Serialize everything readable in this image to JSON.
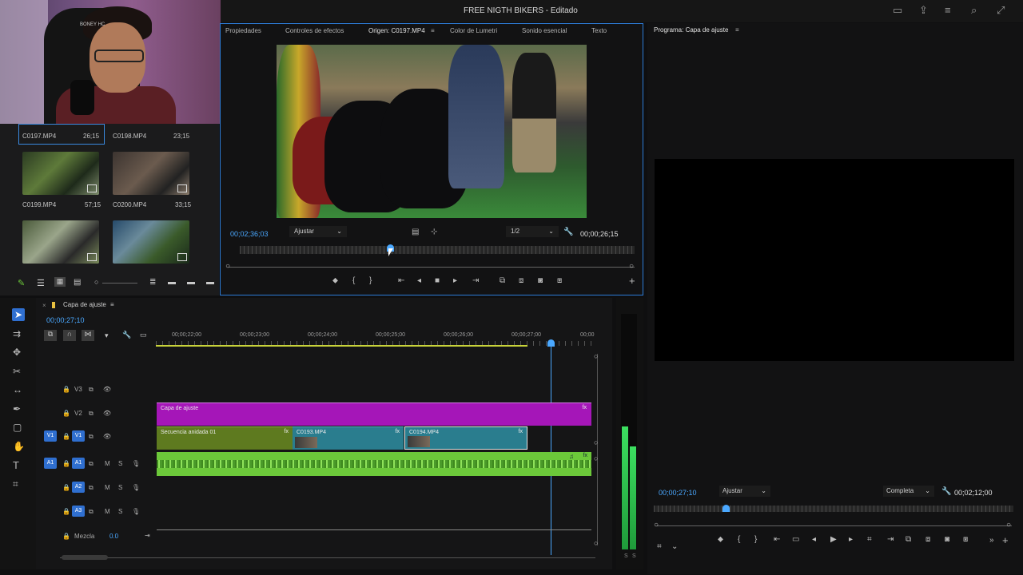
{
  "app": {
    "title": "FREE NIGTH BIKERS - Editado"
  },
  "webcam": {
    "overlay_text": "BONEY HC"
  },
  "bin": {
    "clips": [
      {
        "name": "C0197.MP4",
        "duration": "26;15",
        "selected": true
      },
      {
        "name": "C0198.MP4",
        "duration": "23;15"
      },
      {
        "name": "C0199.MP4",
        "duration": "57;15"
      },
      {
        "name": "C0200.MP4",
        "duration": "33;15"
      }
    ]
  },
  "source": {
    "tabs": [
      "Propiedades",
      "Controles de efectos",
      "Origen: C0197.MP4",
      "Color de Lumetri",
      "Sonido esencial",
      "Texto"
    ],
    "active_tab": 2,
    "timecode_current": "00;02;36;03",
    "fit": "Ajustar",
    "resolution": "1/2",
    "timecode_duration": "00;00;26;15",
    "playhead_fraction": 0.38
  },
  "program": {
    "title": "Programa: Capa de ajuste",
    "timecode_current": "00;00;27;10",
    "fit": "Ajustar",
    "quality": "Completa",
    "timecode_duration": "00;02;12;00",
    "playhead_fraction": 0.2
  },
  "timeline": {
    "sequence_name": "Capa de ajuste",
    "timecode": "00;00;27;10",
    "ruler": [
      "00;00;22;00",
      "00;00;23;00",
      "00;00;24;00",
      "00;00;25;00",
      "00;00;26;00",
      "00;00;27;00",
      "00;00"
    ],
    "tracks": {
      "v3": "V3",
      "v2": "V2",
      "v1": "V1",
      "a1": "A1",
      "a2": "A2",
      "a3": "A3",
      "mix": "Mezcla",
      "mix_value": "0.0",
      "m": "M",
      "s": "S"
    },
    "clips": {
      "adjustment": "Capa de ajuste",
      "nested": "Secuencia anidada 01",
      "c0193": "C0193.MP4",
      "c0194": "C0194.MP4",
      "fx": "fx"
    }
  },
  "colors": {
    "accent": "#2f6fd0",
    "adjustment_layer": "#a516b8",
    "nested_clip": "#5e7a1f",
    "video_clip": "#2a7d8e",
    "audio_clip": "#6cc83a"
  },
  "icons": [
    "marker-icon",
    "in-point-icon",
    "out-point-icon",
    "step-back-icon",
    "play-icon",
    "stop-icon",
    "step-forward-icon",
    "camera-icon",
    "wrench-icon",
    "add-icon"
  ]
}
